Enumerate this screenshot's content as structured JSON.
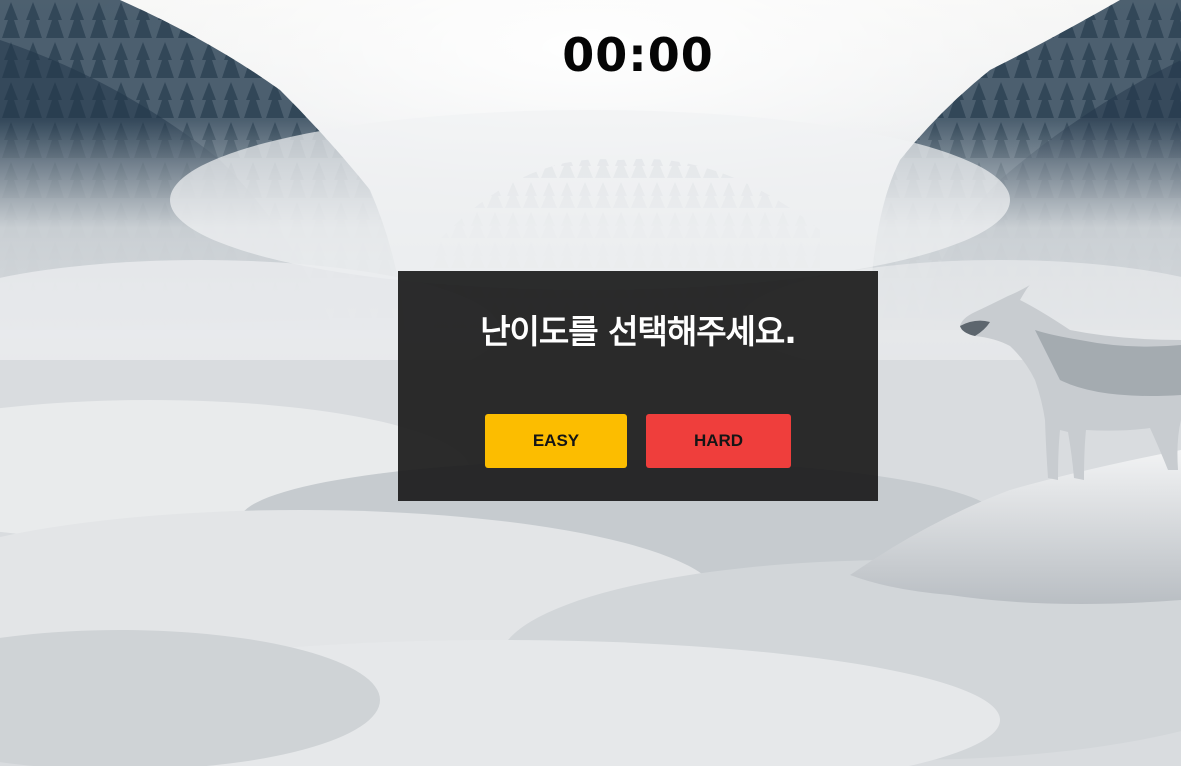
{
  "game": {
    "timer": "00:00"
  },
  "difficulty_modal": {
    "title": "난이도를 선택해주세요.",
    "easy_label": "EASY",
    "hard_label": "HARD"
  },
  "colors": {
    "easy_button": "#fcbd00",
    "hard_button": "#ef3e3c",
    "modal_background": "#161616",
    "timer_text": "#050505"
  },
  "background": {
    "image_name": "foggy-mountain-forest-with-wolf"
  }
}
